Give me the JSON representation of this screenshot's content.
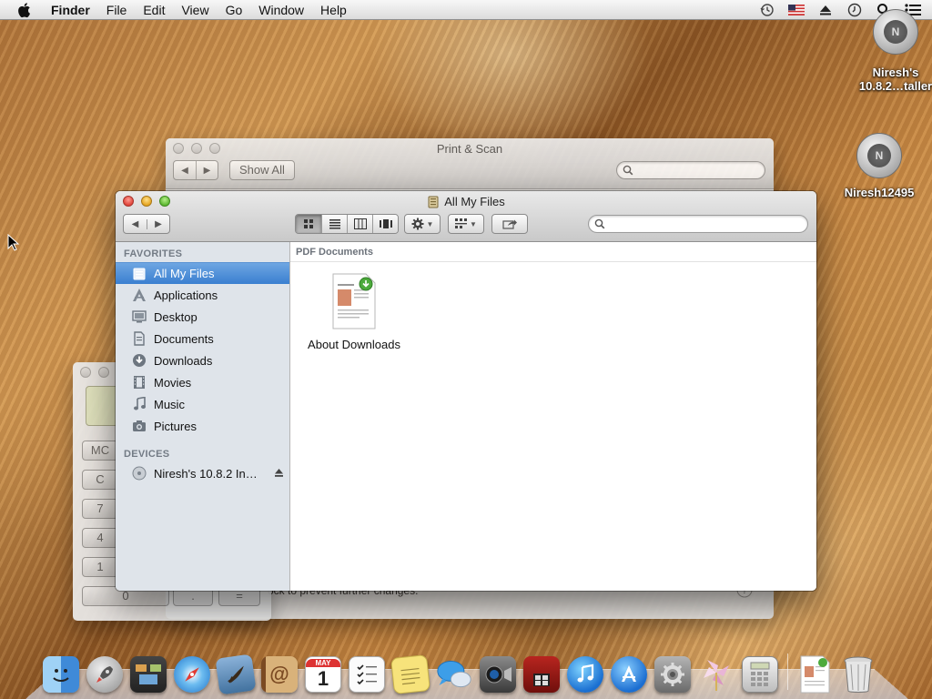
{
  "menubar": {
    "app_name": "Finder",
    "menus": [
      "File",
      "Edit",
      "View",
      "Go",
      "Window",
      "Help"
    ],
    "status_icons": [
      "time-machine-icon",
      "us-flag-input-icon",
      "eject-icon",
      "clock-icon",
      "spotlight-icon",
      "notification-center-icon"
    ]
  },
  "desktop": {
    "items": [
      {
        "label": "Niresh's 10.8.2…taller",
        "badge": "N"
      },
      {
        "label": "Niresh12495",
        "badge": "N"
      }
    ]
  },
  "print_scan": {
    "title": "Print & Scan",
    "show_all": "Show All",
    "footer_text": "ock to prevent further changes."
  },
  "calculator": {
    "keys": [
      "MC",
      "C",
      "7",
      "4",
      "1",
      "0",
      ".",
      "="
    ]
  },
  "finder": {
    "title": "All My Files",
    "sidebar": {
      "favorites_header": "FAVORITES",
      "favorites": [
        {
          "label": "All My Files",
          "icon": "all-my-files-icon",
          "selected": true
        },
        {
          "label": "Applications",
          "icon": "applications-icon"
        },
        {
          "label": "Desktop",
          "icon": "desktop-icon"
        },
        {
          "label": "Documents",
          "icon": "documents-icon"
        },
        {
          "label": "Downloads",
          "icon": "downloads-icon"
        },
        {
          "label": "Movies",
          "icon": "movies-icon"
        },
        {
          "label": "Music",
          "icon": "music-icon"
        },
        {
          "label": "Pictures",
          "icon": "pictures-icon"
        }
      ],
      "devices_header": "DEVICES",
      "devices": [
        {
          "label": "Niresh's 10.8.2 In…",
          "icon": "disk-icon"
        }
      ]
    },
    "content": {
      "group_header": "PDF Documents",
      "files": [
        {
          "label": "About Downloads",
          "icon": "pdf-document-icon"
        }
      ]
    }
  },
  "dock": {
    "apps": [
      "Finder",
      "Launchpad",
      "Mission Control",
      "Safari",
      "Mail",
      "Contacts",
      "Calendar",
      "Reminders",
      "Notes",
      "Messages",
      "FaceTime",
      "Photo Booth",
      "iTunes",
      "App Store",
      "System Preferences",
      "Pinwheel",
      "Calculator",
      "About Downloads",
      "Trash"
    ],
    "calendar_month": "MAY",
    "calendar_day": "1"
  },
  "colors": {
    "selection": "#3a7fd0",
    "sidebar_bg": "#dfe4ea"
  }
}
